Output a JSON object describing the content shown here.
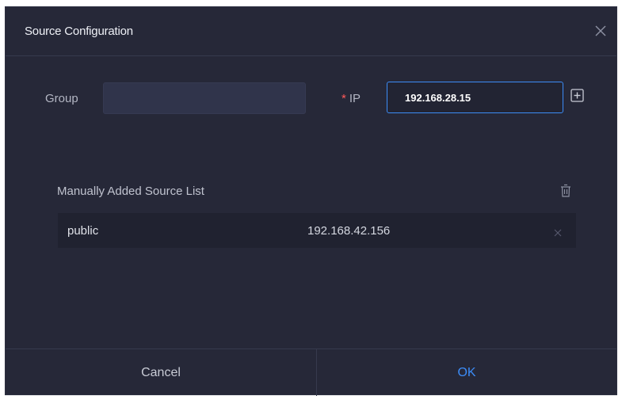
{
  "dialog": {
    "title": "Source Configuration"
  },
  "form": {
    "group_label": "Group",
    "group_value": "",
    "ip_required_mark": "*",
    "ip_label": "IP",
    "ip_value": "192.168.28.15"
  },
  "source_list": {
    "title": "Manually Added Source List",
    "rows": [
      {
        "name": "public",
        "ip": "192.168.42.156"
      }
    ]
  },
  "footer": {
    "cancel_label": "Cancel",
    "ok_label": "OK"
  },
  "colors": {
    "background": "#262838",
    "accent": "#3c8cf7",
    "required": "#ff5a5a",
    "row_background": "#202230"
  },
  "icons": {
    "close": "close-icon",
    "add": "plus-square-icon",
    "delete_all": "trash-icon",
    "remove_row": "close-icon"
  }
}
